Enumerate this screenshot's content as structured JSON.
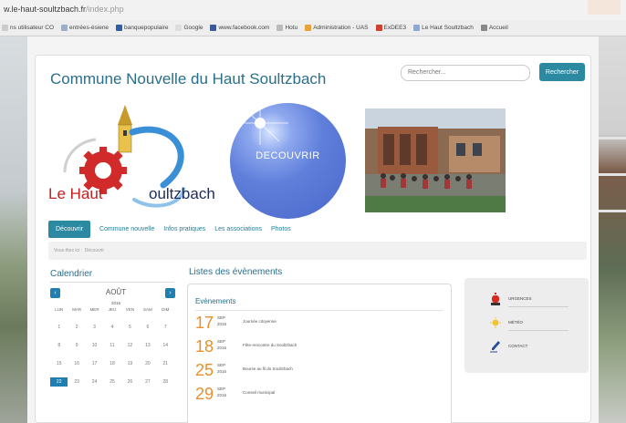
{
  "browser": {
    "url_host": "w.le-haut-soultzbach.fr",
    "url_path": "/index.php",
    "bookmarks": [
      {
        "label": "ns utilisateur CO",
        "icon": "bookmark-icon",
        "color": "#cccccc"
      },
      {
        "label": "entrées-ésiene",
        "icon": "page-icon",
        "color": "#9ab0c8"
      },
      {
        "label": "banquepopulaire",
        "icon": "bank-icon",
        "color": "#2b5fa8"
      },
      {
        "label": "Google",
        "icon": "google-icon",
        "color": "#dddddd"
      },
      {
        "label": "www.facebook.com",
        "icon": "facebook-icon",
        "color": "#3b5998"
      },
      {
        "label": "Hotu",
        "icon": "page-icon",
        "color": "#bbbbbb"
      },
      {
        "label": "Administration - UAS",
        "icon": "admin-icon",
        "color": "#e9a23b"
      },
      {
        "label": "ExDEE3",
        "icon": "page-icon",
        "color": "#d04030"
      },
      {
        "label": "Le Haut Soultzbach",
        "icon": "site-icon",
        "color": "#8aa9d6"
      },
      {
        "label": "Accueil",
        "icon": "home-icon",
        "color": "#888888"
      }
    ]
  },
  "site": {
    "title": "Commune Nouvelle du Haut Soultzbach",
    "search_placeholder": "Rechercher...",
    "search_button": "Rechercher"
  },
  "logo": {
    "text_left": "Le Haut",
    "text_right": "oultzbach"
  },
  "discover": {
    "label": "DECOUVRIR"
  },
  "nav": {
    "items": [
      "Découvrir",
      "Commune nouvelle",
      "Infos pratiques",
      "Les associations",
      "Photos"
    ]
  },
  "breadcrumb": {
    "items": [
      "Vous êtes ici :",
      "Découvrir"
    ]
  },
  "calendar": {
    "title": "Calendrier",
    "month": "AOÛT",
    "year": "2016",
    "day_names": [
      "LUN",
      "MAR",
      "MER",
      "JEU",
      "VEN",
      "SAM",
      "DIM"
    ],
    "days": [
      "1",
      "2",
      "3",
      "4",
      "5",
      "6",
      "7",
      "8",
      "9",
      "10",
      "11",
      "12",
      "13",
      "14",
      "15",
      "16",
      "17",
      "18",
      "19",
      "20",
      "21",
      "22",
      "23",
      "24",
      "25",
      "26",
      "27",
      "28"
    ],
    "today": "22",
    "accent": "#1f7fb0"
  },
  "events": {
    "title": "Listes des évènements",
    "box_title": "Evènements",
    "accent": "#e9902c",
    "items": [
      {
        "day": "17",
        "month": "SEP",
        "year": "2016",
        "name": "Journée citoyenne"
      },
      {
        "day": "18",
        "month": "SEP",
        "year": "2016",
        "name": "Fête-rencontre du Soultzbach"
      },
      {
        "day": "25",
        "month": "SEP",
        "year": "2016",
        "name": "Bourse au fil du Soultzbach"
      },
      {
        "day": "29",
        "month": "SEP",
        "year": "2016",
        "name": "Conseil municipal"
      }
    ]
  },
  "sidebar": {
    "items": [
      {
        "label": "URGENCES",
        "icon": "siren-icon",
        "color": "#d42a20"
      },
      {
        "label": "MÉTÉO",
        "icon": "sun-icon",
        "color": "#f2c230"
      },
      {
        "label": "CONTACT",
        "icon": "pen-icon",
        "color": "#2a4f9a"
      }
    ]
  },
  "colors": {
    "title": "#2a6f89",
    "primary_button": "#2b8aa2"
  }
}
